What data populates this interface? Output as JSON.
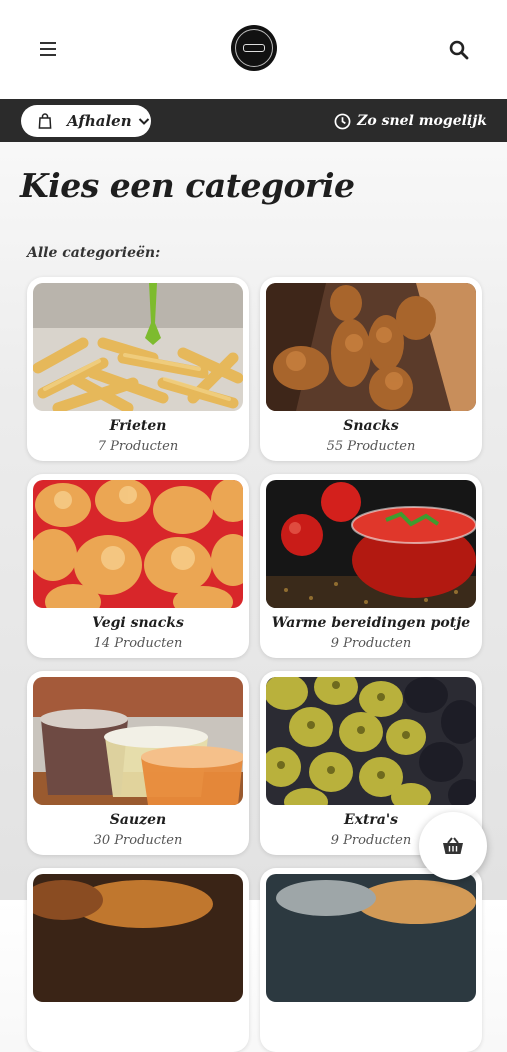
{
  "header": {
    "menu_icon": "hamburger-icon",
    "logo_icon": "restaurant-logo",
    "search_icon": "search-icon"
  },
  "order_bar": {
    "mode_label": "Afhalen",
    "mode_icon": "shopping-bag-icon",
    "time_label": "Zo snel mogelijk",
    "time_icon": "clock-icon"
  },
  "page": {
    "title": "Kies een categorie",
    "subtitle": "Alle categorieën:"
  },
  "categories": [
    {
      "name": "Frieten",
      "count": "7 Producten",
      "image": "fries-photo"
    },
    {
      "name": "Snacks",
      "count": "55 Producten",
      "image": "fried-snacks-photo"
    },
    {
      "name": "Vegi snacks",
      "count": "14 Producten",
      "image": "cheese-bites-photo"
    },
    {
      "name": "Warme bereidingen potje",
      "count": "9 Producten",
      "image": "tomato-sauce-jar-photo"
    },
    {
      "name": "Sauzen",
      "count": "30 Producten",
      "image": "sauce-cups-photo"
    },
    {
      "name": "Extra's",
      "count": "9 Producten",
      "image": "olives-photo"
    },
    {
      "name": "",
      "count": "",
      "image": "burger-photo"
    },
    {
      "name": "",
      "count": "",
      "image": "bun-photo"
    }
  ],
  "cart": {
    "icon": "basket-icon"
  },
  "colors": {
    "bar": "#2b2b2b",
    "card": "#ffffff",
    "text": "#1e1e1e"
  }
}
